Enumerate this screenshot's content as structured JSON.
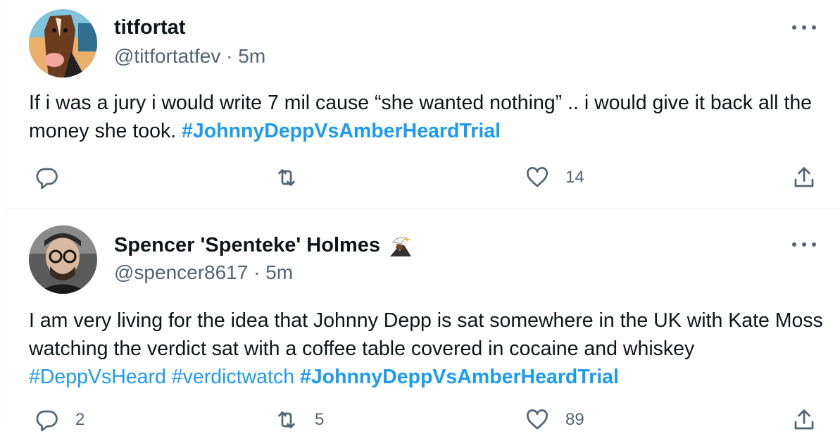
{
  "tweets": [
    {
      "name": "titfortat",
      "handle": "@titfortatfev",
      "separator": "·",
      "time": "5m",
      "text_parts": [
        {
          "text": "If i was a jury i would write 7 mil cause “she wanted nothing” .. i would give it back all the money she took. ",
          "type": "plain"
        },
        {
          "text": "#JohnnyDeppVsAmberHeardTrial",
          "type": "hashtag-bold"
        }
      ],
      "counts": {
        "reply": "",
        "retweet": "",
        "like": "14"
      }
    },
    {
      "name": "Spencer 'Spenteke' Holmes",
      "handle": "@spencer8617",
      "separator": "·",
      "time": "5m",
      "text_parts": [
        {
          "text": "I am very living for the idea that Johnny Depp is sat somewhere in the UK with Kate Moss watching the verdict sat with a coffee table covered in cocaine and whiskey ",
          "type": "plain"
        },
        {
          "text": "#DeppVsHeard",
          "type": "hashtag"
        },
        {
          "text": " ",
          "type": "plain"
        },
        {
          "text": "#verdictwatch",
          "type": "hashtag"
        },
        {
          "text": " ",
          "type": "plain"
        },
        {
          "text": "#JohnnyDeppVsAmberHeardTrial",
          "type": "hashtag-bold"
        }
      ],
      "counts": {
        "reply": "2",
        "retweet": "5",
        "like": "89"
      }
    }
  ],
  "colors": {
    "link": "#1d9bf0",
    "secondary": "#536471",
    "text": "#0f1419"
  }
}
